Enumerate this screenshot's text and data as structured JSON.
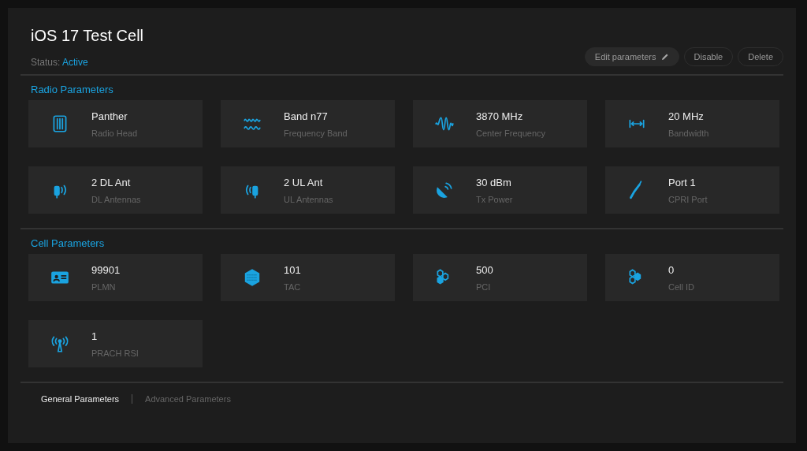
{
  "title": "iOS 17 Test Cell",
  "status": {
    "label": "Status:",
    "value": "Active"
  },
  "actions": [
    {
      "label": "Edit parameters",
      "kind": "edit"
    },
    {
      "label": "Disable",
      "kind": "outline"
    },
    {
      "label": "Delete",
      "kind": "outline"
    }
  ],
  "sections": [
    {
      "title": "Radio Parameters",
      "cards": [
        {
          "value": "Panther",
          "label": "Radio Head"
        },
        {
          "value": "Band n77",
          "label": "Frequency Band"
        },
        {
          "value": "3870 MHz",
          "label": "Center Frequency"
        },
        {
          "value": "20 MHz",
          "label": "Bandwidth"
        },
        {
          "value": "2 DL Ant",
          "label": "DL Antennas"
        },
        {
          "value": "2 UL Ant",
          "label": "UL Antennas"
        },
        {
          "value": "30 dBm",
          "label": "Tx Power"
        },
        {
          "value": "Port 1",
          "label": "CPRI Port"
        }
      ]
    },
    {
      "title": "Cell Parameters",
      "cards": [
        {
          "value": "99901",
          "label": "PLMN"
        },
        {
          "value": "101",
          "label": "TAC"
        },
        {
          "value": "500",
          "label": "PCI"
        },
        {
          "value": "0",
          "label": "Cell ID"
        },
        {
          "value": "1",
          "label": "PRACH RSI"
        }
      ]
    }
  ],
  "tabs": [
    {
      "label": "General Parameters",
      "selected": true
    },
    {
      "label": "Advanced Parameters",
      "selected": false
    }
  ]
}
